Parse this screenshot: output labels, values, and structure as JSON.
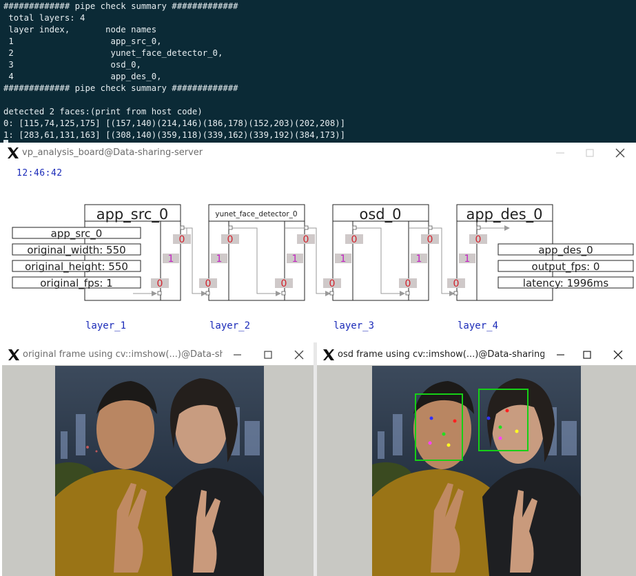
{
  "terminal": {
    "lines": [
      "############# pipe check summary #############",
      " total layers: 4",
      " layer index,       node names",
      " 1                   app_src_0,",
      " 2                   yunet_face_detector_0,",
      " 3                   osd_0,",
      " 4                   app_des_0,",
      "############# pipe check summary #############",
      "",
      "detected 2 faces:(print from host code)",
      "0: [115,74,125,175] [(157,140)(214,146)(186,178)(152,203)(202,208)]",
      "1: [283,61,131,163] [(308,140)(359,118)(339,162)(339,192)(384,173)]"
    ]
  },
  "board": {
    "title": "vp_analysis_board@Data-sharing-server",
    "time": "12:46:42",
    "nodes": [
      {
        "name": "app_src_0",
        "layer": "layer_1"
      },
      {
        "name": "yunet_face_detector_0",
        "layer": "layer_2"
      },
      {
        "name": "osd_0",
        "layer": "layer_3"
      },
      {
        "name": "app_des_0",
        "layer": "layer_4"
      }
    ],
    "src_info": [
      "app_src_0",
      "original_width: 550",
      "original_height: 550",
      "original_fps: 1"
    ],
    "des_info": [
      "app_des_0",
      "output_fps: 0",
      "latency: 1996ms"
    ],
    "port_zero": "0",
    "port_one": "1"
  },
  "original_window": {
    "title": "original frame using cv::imshow(...)@Data-shari..."
  },
  "osd_window": {
    "title": "osd frame using cv::imshow(...)@Data-sharing-se..."
  },
  "colors": {
    "terminal_bg": "#0b2a36",
    "terminal_fg": "#e6edf0",
    "board_time": "#1a2ab8",
    "layer_label": "#1a2ab8",
    "port_badge_bg": "#cfc9c9",
    "port_zero_text": "#d0202a",
    "port_one_text": "#c020c0",
    "face_box": "#16d016"
  }
}
